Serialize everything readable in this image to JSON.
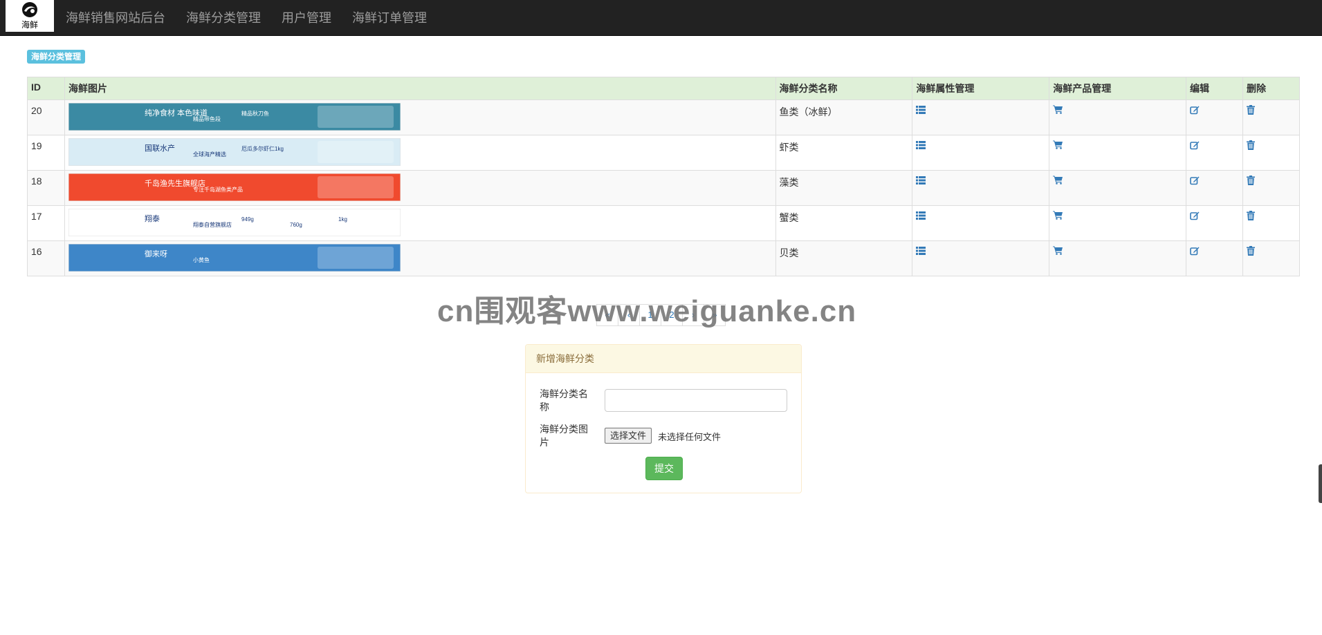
{
  "brand": {
    "text": "海鲜",
    "icon": "fish-logo-icon"
  },
  "nav": {
    "items": [
      "海鲜销售网站后台",
      "海鲜分类管理",
      "用户管理",
      "海鲜订单管理"
    ]
  },
  "page_label": "海鲜分类管理",
  "table": {
    "headers": [
      "ID",
      "海鲜图片",
      "海鲜分类名称",
      "海鲜属性管理",
      "海鲜产品管理",
      "编辑",
      "删除"
    ],
    "rows": [
      {
        "id": "20",
        "name": "鱼类（冰鲜）",
        "banner": {
          "bg": "#3b8aa3",
          "texts": [
            "纯净食材 本色味道",
            "精品带鱼段",
            "精品秋刀鱼"
          ]
        }
      },
      {
        "id": "19",
        "name": "虾类",
        "banner": {
          "bg": "#d9ecf5",
          "texts": [
            "国联水产",
            "全球海产精选",
            "厄瓜多尔虾仁1kg"
          ]
        }
      },
      {
        "id": "18",
        "name": "藻类",
        "banner": {
          "bg": "#f04a2e",
          "texts": [
            "千岛渔先生旗舰店",
            "专注千岛湖鱼类产品"
          ]
        }
      },
      {
        "id": "17",
        "name": "蟹类",
        "banner": {
          "bg": "#ffffff",
          "texts": [
            "翔泰",
            "翔泰自营旗舰店",
            "949g",
            "760g",
            "1kg"
          ]
        }
      },
      {
        "id": "16",
        "name": "贝类",
        "banner": {
          "bg": "#3e86c8",
          "texts": [
            "御来呀",
            "小黄鱼"
          ]
        }
      }
    ],
    "action_icons": {
      "attributes": "list-icon",
      "products": "cart-icon",
      "edit": "edit-icon",
      "delete": "trash-icon"
    },
    "icon_color": "#337ab7"
  },
  "pagination": {
    "items": [
      "«",
      "‹",
      "1",
      "2",
      "›",
      "»"
    ]
  },
  "watermark": "cn围观客www.weiguanke.cn",
  "form": {
    "title": "新增海鲜分类",
    "name_label": "海鲜分类名称",
    "name_value": "",
    "image_label": "海鲜分类图片",
    "file_button": "选择文件",
    "file_status": "未选择任何文件",
    "submit": "提交"
  },
  "colors": {
    "navbar": "#222222",
    "table_header": "#dff0d8",
    "label": "#5bc0de",
    "panel_heading": "#fcf8e3",
    "submit": "#5cb85c"
  }
}
